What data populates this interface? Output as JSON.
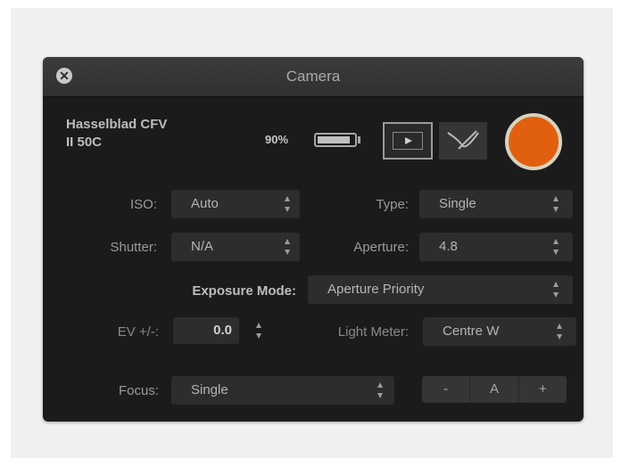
{
  "window": {
    "title": "Camera"
  },
  "camera": {
    "name_line1": "Hasselblad CFV",
    "name_line2": "II 50C",
    "battery_pct": "90%",
    "battery_level": 0.9
  },
  "settings": {
    "iso": {
      "label": "ISO:",
      "value": "Auto"
    },
    "type": {
      "label": "Type:",
      "value": "Single"
    },
    "shutter": {
      "label": "Shutter:",
      "value": "N/A"
    },
    "aperture": {
      "label": "Aperture:",
      "value": "4.8"
    },
    "exposure_mode": {
      "label": "Exposure Mode:",
      "value": "Aperture Priority"
    },
    "ev": {
      "label": "EV +/-:",
      "value": "0.0"
    },
    "light_meter": {
      "label": "Light Meter:",
      "value": "Centre W"
    },
    "focus": {
      "label": "Focus:",
      "value": "Single"
    },
    "focus_buttons": {
      "minus": "-",
      "auto": "A",
      "plus": "+"
    }
  },
  "colors": {
    "record": "#e06010",
    "window_bg": "#1b1b1b"
  },
  "icons": [
    "close-icon",
    "play-icon",
    "curve-icon",
    "battery-icon",
    "record-button"
  ]
}
